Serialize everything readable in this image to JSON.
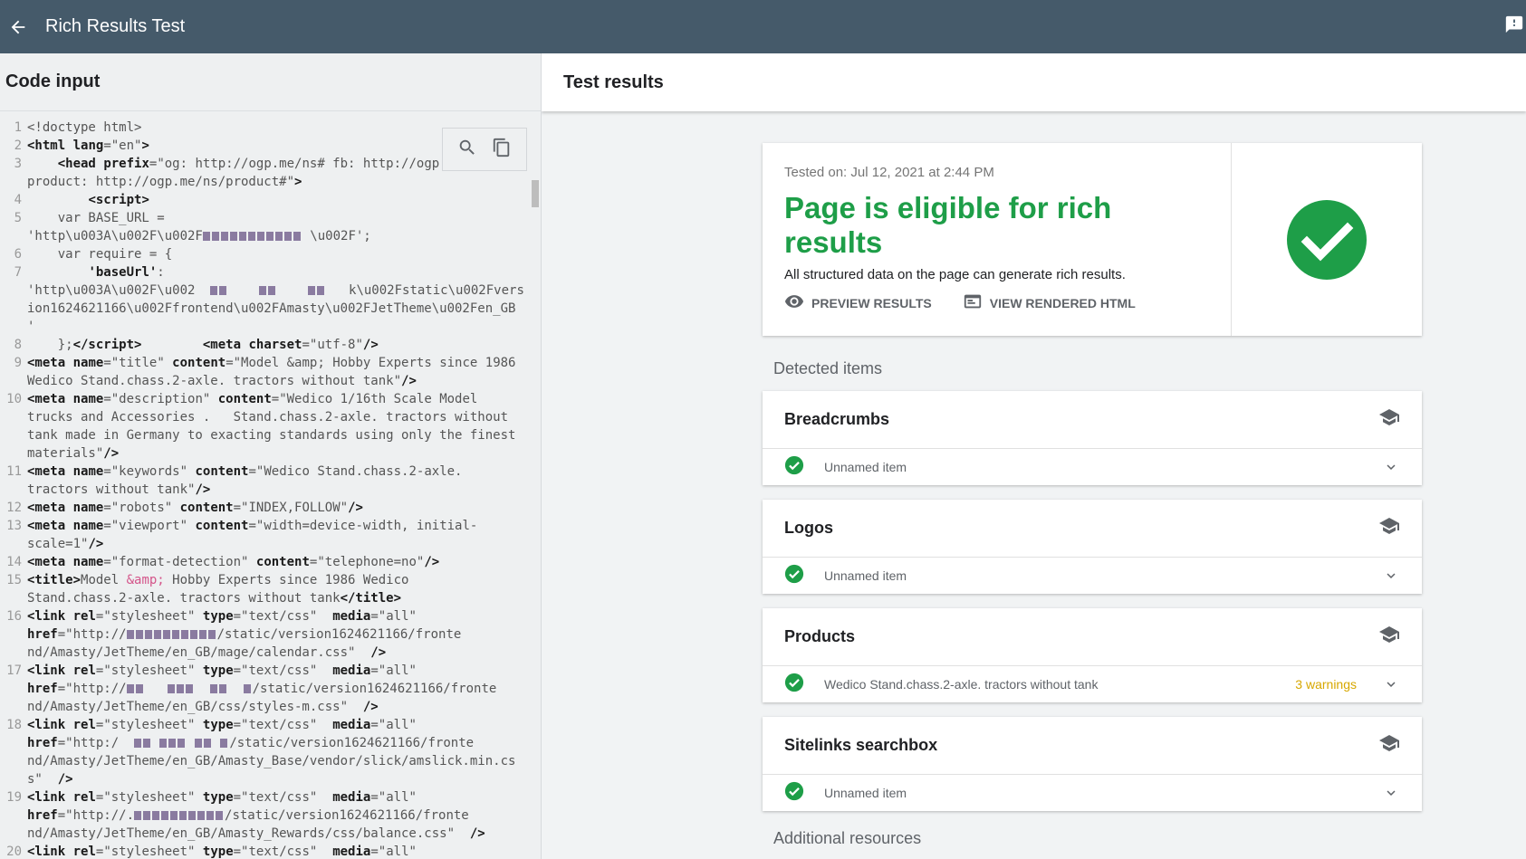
{
  "app": {
    "title": "Rich Results Test"
  },
  "left": {
    "header": "Code input",
    "lines": [
      {
        "n": "1",
        "html": "<span class='txt'>&lt;!doctype html&gt;</span>"
      },
      {
        "n": "2",
        "html": "<span class='tag'>&lt;html</span> <span class='attr'>lang</span><span class='txt'>=\"en\"</span><span class='tag'>&gt;</span>"
      },
      {
        "n": "3",
        "html": "<span class='txt'>    </span><span class='tag'>&lt;head</span> <span class='attr'>prefix</span><span class='txt'>=\"og: http://ogp.me/ns# fb: http://ogp</span>"
      },
      {
        "n": "",
        "html": "<span class='txt'>product: http://ogp.me/ns/product#\"</span><span class='tag'>&gt;</span>"
      },
      {
        "n": "4",
        "html": "<span class='txt'>        </span><span class='tag'>&lt;script&gt;</span>"
      },
      {
        "n": "5",
        "html": "<span class='txt'>    var BASE_URL =</span>"
      },
      {
        "n": "",
        "html": "<span class='txt'>'http\\u003A\\u002F\\u002F</span><span class='blur'></span><span class='blur'></span><span class='blur'></span><span class='blur'></span><span class='blur'></span><span class='blur'></span><span class='blur'></span><span class='blur'></span><span class='blur'></span><span class='blur'></span><span class='blur'></span><span class='txt'> \\u002F';</span>"
      },
      {
        "n": "6",
        "html": "<span class='txt'>    var require = {</span>"
      },
      {
        "n": "7",
        "html": "<span class='txt'>        </span><span class='tag'>'baseUrl'</span><span class='txt'>:</span>"
      },
      {
        "n": "",
        "html": "<span class='txt'>'http\\u003A\\u002F\\u002</span><span class='txt'>  </span><span class='blur'></span><span class='blur'></span><span class='txt'>    </span><span class='blur'></span><span class='blur'></span><span class='txt'>    </span><span class='blur'></span><span class='blur'></span><span class='txt'>   k\\u002Fstatic\\u002Fvers</span>"
      },
      {
        "n": "",
        "html": "<span class='txt'>ion1624621166\\u002Ffrontend\\u002FAmasty\\u002FJetTheme\\u002Fen_GB</span>"
      },
      {
        "n": "",
        "html": "<span class='txt'>'</span>"
      },
      {
        "n": "8",
        "html": "<span class='txt'>    };</span><span class='tag'>&lt;/script&gt;</span><span class='txt'>        </span><span class='tag'>&lt;meta</span> <span class='attr'>charset</span><span class='txt'>=\"utf-8\"</span><span class='tag'>/&gt;</span>"
      },
      {
        "n": "9",
        "html": "<span class='tag'>&lt;meta</span> <span class='attr'>name</span><span class='txt'>=\"title\" </span><span class='attr'>content</span><span class='txt'>=\"Model &amp;amp; Hobby Experts since 1986</span>"
      },
      {
        "n": "",
        "html": "<span class='txt'>Wedico Stand.chass.2-axle. tractors without tank\"</span><span class='tag'>/&gt;</span>"
      },
      {
        "n": "10",
        "html": "<span class='tag'>&lt;meta</span> <span class='attr'>name</span><span class='txt'>=\"description\" </span><span class='attr'>content</span><span class='txt'>=\"Wedico 1/16th Scale Model</span>"
      },
      {
        "n": "",
        "html": "<span class='txt'>trucks and Accessories .   Stand.chass.2-axle. tractors without</span>"
      },
      {
        "n": "",
        "html": "<span class='txt'>tank made in Germany to exacting standards using only the finest</span>"
      },
      {
        "n": "",
        "html": "<span class='txt'>materials\"</span><span class='tag'>/&gt;</span>"
      },
      {
        "n": "11",
        "html": "<span class='tag'>&lt;meta</span> <span class='attr'>name</span><span class='txt'>=\"keywords\" </span><span class='attr'>content</span><span class='txt'>=\"Wedico Stand.chass.2-axle.</span>"
      },
      {
        "n": "",
        "html": "<span class='txt'>tractors without tank\"</span><span class='tag'>/&gt;</span>"
      },
      {
        "n": "12",
        "html": "<span class='tag'>&lt;meta</span> <span class='attr'>name</span><span class='txt'>=\"robots\" </span><span class='attr'>content</span><span class='txt'>=\"INDEX,FOLLOW\"</span><span class='tag'>/&gt;</span>"
      },
      {
        "n": "13",
        "html": "<span class='tag'>&lt;meta</span> <span class='attr'>name</span><span class='txt'>=\"viewport\" </span><span class='attr'>content</span><span class='txt'>=\"width=device-width, initial-</span>"
      },
      {
        "n": "",
        "html": "<span class='txt'>scale=1\"</span><span class='tag'>/&gt;</span>"
      },
      {
        "n": "14",
        "html": "<span class='tag'>&lt;meta</span> <span class='attr'>name</span><span class='txt'>=\"format-detection\" </span><span class='attr'>content</span><span class='txt'>=\"telephone=no\"</span><span class='tag'>/&gt;</span>"
      },
      {
        "n": "15",
        "html": "<span class='tag'>&lt;title&gt;</span><span class='txt'>Model </span><span class='amp'>&amp;amp;</span><span class='txt'> Hobby Experts since 1986 Wedico</span>"
      },
      {
        "n": "",
        "html": "<span class='txt'>Stand.chass.2-axle. tractors without tank</span><span class='tag'>&lt;/title&gt;</span>"
      },
      {
        "n": "16",
        "html": "<span class='tag'>&lt;link</span>  <span class='attr'>rel</span><span class='txt'>=\"stylesheet\" </span><span class='attr'>type</span><span class='txt'>=\"text/css\"  </span><span class='attr'>media</span><span class='txt'>=\"all\"</span>"
      },
      {
        "n": "",
        "html": "<span class='attr'>href</span><span class='txt'>=\"http://</span><span class='blur'></span><span class='blur'></span><span class='blur'></span><span class='blur'></span><span class='blur'></span><span class='blur'></span><span class='blur'></span><span class='blur'></span><span class='blur'></span><span class='blur'></span><span class='txt'>/static/version1624621166/fronte</span>"
      },
      {
        "n": "",
        "html": "<span class='txt'>nd/Amasty/JetTheme/en_GB/mage/calendar.css\"  </span><span class='tag'>/&gt;</span>"
      },
      {
        "n": "17",
        "html": "<span class='tag'>&lt;link</span>  <span class='attr'>rel</span><span class='txt'>=\"stylesheet\" </span><span class='attr'>type</span><span class='txt'>=\"text/css\"  </span><span class='attr'>media</span><span class='txt'>=\"all\"</span>"
      },
      {
        "n": "",
        "html": "<span class='attr'>href</span><span class='txt'>=\"http://</span><span class='blur'></span><span class='blur'></span><span class='txt'>   </span><span class='blur'></span><span class='blur'></span><span class='blur'></span><span class='txt'>  </span><span class='blur'></span><span class='blur'></span><span class='txt'>  </span><span class='blur'></span><span class='txt'>/static/version1624621166/fronte</span>"
      },
      {
        "n": "",
        "html": "<span class='txt'>nd/Amasty/JetTheme/en_GB/css/styles-m.css\"  </span><span class='tag'>/&gt;</span>"
      },
      {
        "n": "18",
        "html": "<span class='tag'>&lt;link</span>  <span class='attr'>rel</span><span class='txt'>=\"stylesheet\" </span><span class='attr'>type</span><span class='txt'>=\"text/css\"  </span><span class='attr'>media</span><span class='txt'>=\"all\"</span>"
      },
      {
        "n": "",
        "html": "<span class='attr'>href</span><span class='txt'>=\"http:/  </span><span class='blur'></span><span class='blur'></span><span class='txt'> </span><span class='blur'></span><span class='blur'></span><span class='blur'></span><span class='txt'> </span><span class='blur'></span><span class='blur'></span><span class='txt'> </span><span class='blur'></span><span class='txt'>/static/version1624621166/fronte</span>"
      },
      {
        "n": "",
        "html": "<span class='txt'>nd/Amasty/JetTheme/en_GB/Amasty_Base/vendor/slick/amslick.min.cs</span>"
      },
      {
        "n": "",
        "html": "<span class='txt'>s\"  </span><span class='tag'>/&gt;</span>"
      },
      {
        "n": "19",
        "html": "<span class='tag'>&lt;link</span>  <span class='attr'>rel</span><span class='txt'>=\"stylesheet\" </span><span class='attr'>type</span><span class='txt'>=\"text/css\"  </span><span class='attr'>media</span><span class='txt'>=\"all\"</span>"
      },
      {
        "n": "",
        "html": "<span class='attr'>href</span><span class='txt'>=\"http://.</span><span class='blur'></span><span class='blur'></span><span class='blur'></span><span class='blur'></span><span class='blur'></span><span class='blur'></span><span class='blur'></span><span class='blur'></span><span class='blur'></span><span class='blur'></span><span class='txt'>/static/version1624621166/fronte</span>"
      },
      {
        "n": "",
        "html": "<span class='txt'>nd/Amasty/JetTheme/en_GB/Amasty_Rewards/css/balance.css\"  </span><span class='tag'>/&gt;</span>"
      },
      {
        "n": "20",
        "html": "<span class='tag'>&lt;link</span>  <span class='attr'>rel</span><span class='txt'>=\"stylesheet\" </span><span class='attr'>type</span><span class='txt'>=\"text/css\"  </span><span class='attr'>media</span><span class='txt'>=\"all\"</span>"
      }
    ]
  },
  "right": {
    "header": "Test results",
    "summary": {
      "tested_on": "Tested on: Jul 12, 2021 at 2:44 PM",
      "verdict": "Page is eligible for rich results",
      "verdict_sub": "All structured data on the page can generate rich results.",
      "preview_label": "PREVIEW RESULTS",
      "html_label": "VIEW RENDERED HTML"
    },
    "detected_label": "Detected items",
    "items": [
      {
        "title": "Breadcrumbs",
        "row": "Unnamed item",
        "warnings": ""
      },
      {
        "title": "Logos",
        "row": "Unnamed item",
        "warnings": ""
      },
      {
        "title": "Products",
        "row": "Wedico Stand.chass.2-axle. tractors without tank",
        "warnings": "3 warnings"
      },
      {
        "title": "Sitelinks searchbox",
        "row": "Unnamed item",
        "warnings": ""
      }
    ],
    "additional_label": "Additional resources"
  },
  "colors": {
    "topbar": "#455a6a",
    "success": "#1e9e48",
    "warning": "#d7a700"
  }
}
